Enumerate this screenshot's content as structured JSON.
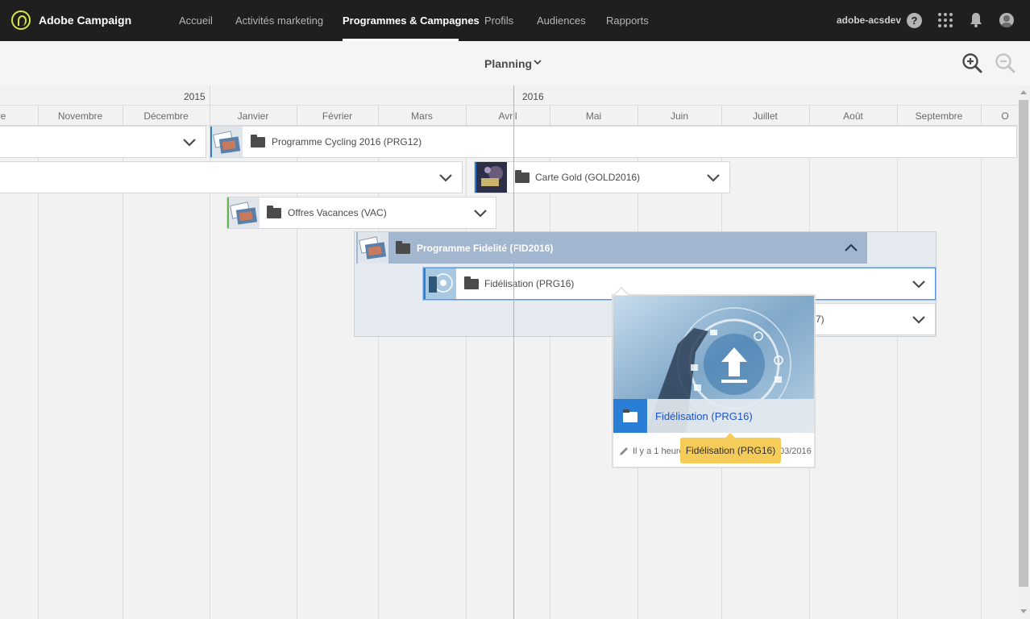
{
  "app": {
    "brand": "Adobe Campaign"
  },
  "nav": {
    "items": [
      {
        "label": "Accueil"
      },
      {
        "label": "Activités marketing"
      },
      {
        "label": "Programmes & Campagnes"
      },
      {
        "label": "Profils"
      },
      {
        "label": "Audiences"
      },
      {
        "label": "Rapports"
      }
    ],
    "active": "Programmes & Campagnes",
    "user": "adobe-acsdev",
    "help_glyph": "?"
  },
  "view": {
    "title": "Planning"
  },
  "timeline": {
    "years": [
      "2015",
      "2016"
    ],
    "months": [
      "ore",
      "Novembre",
      "Décembre",
      "Janvier",
      "Février",
      "Mars",
      "Avril",
      "Mai",
      "Juin",
      "Juillet",
      "Août",
      "Septembre",
      "O"
    ]
  },
  "bars": [
    {
      "label": "Programme Cycling 2016 (PRG12)"
    },
    {
      "label": "Carte Gold (GOLD2016)"
    },
    {
      "label": "Offres Vacances (VAC)"
    },
    {
      "label": "Programme Fidelité (FID2016)"
    },
    {
      "label": "Fidélisation (PRG16)"
    },
    {
      "label": "7)"
    }
  ],
  "card": {
    "title": "Fidélisation (PRG16)",
    "meta": "Il y a 1 heure",
    "date": "03/2016"
  },
  "tooltip": {
    "text": "Fidélisation (PRG16)"
  },
  "colors": {
    "accent_blue": "#2b7ed6",
    "group_header": "#a3b6cf",
    "tooltip": "#f5cc59",
    "logo": "#d7e64b"
  }
}
